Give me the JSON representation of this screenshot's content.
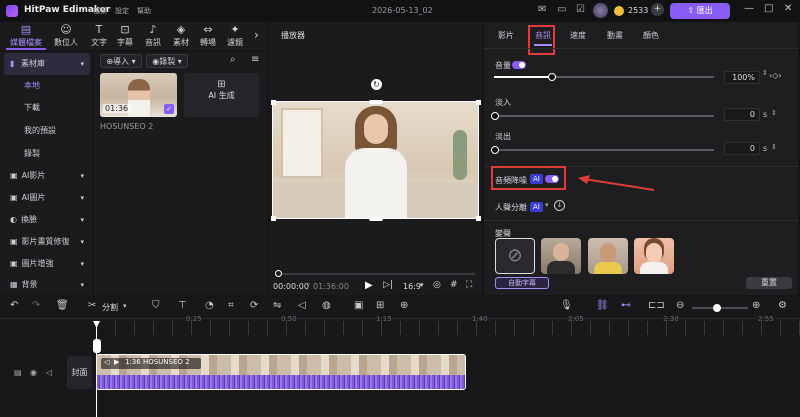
{
  "app": {
    "title": "HitPaw Edimakor",
    "date": "2026-05-13_02",
    "coins": "2533",
    "export_label": "匯出"
  },
  "menu": [
    "檔案",
    "設定",
    "幫助"
  ],
  "toolbar": [
    {
      "label": "媒體檔案",
      "icon": "media-icon"
    },
    {
      "label": "數位人",
      "icon": "avatar-icon"
    },
    {
      "label": "文字",
      "icon": "text-icon"
    },
    {
      "label": "字幕",
      "icon": "subtitle-icon"
    },
    {
      "label": "音訊",
      "icon": "music-icon"
    },
    {
      "label": "素材",
      "icon": "assets-icon"
    },
    {
      "label": "轉場",
      "icon": "transition-icon"
    },
    {
      "label": "濾鏡",
      "icon": "filter-icon"
    }
  ],
  "leftnav": {
    "library": "素材庫",
    "items": [
      "本地",
      "下載",
      "我的預設",
      "錄製"
    ],
    "groups": [
      "AI影片",
      "AI圖片",
      "換臉",
      "影片畫質修復",
      "圖片增強",
      "背景"
    ]
  },
  "mediabin": {
    "import_label": "導入",
    "record_label": "錄製",
    "clip_name": "HOSUNSEO 2",
    "clip_duration": "01:36",
    "ai_generate_label": "AI 生成"
  },
  "preview": {
    "title": "播放器",
    "current_time": "00:00:00",
    "total_time": "01:36:00",
    "ratio": "16:9"
  },
  "props": {
    "tabs": [
      "影片",
      "音訊",
      "速度",
      "動畫",
      "顏色"
    ],
    "active_tab": "音訊",
    "volume_label": "音量",
    "volume_value": "100%",
    "volume_level": 1.0,
    "fade_in_label": "淡入",
    "fade_in_value": "0",
    "fade_out_label": "淡出",
    "fade_out_value": "0",
    "unit_s": "s",
    "noise_label": "音頻降噪",
    "ai_badge": "AI",
    "vocal_label": "人聲分離",
    "voice_change_label": "變聲",
    "auto_subtitle_label": "自動字幕",
    "reset_label": "重置"
  },
  "timeline": {
    "ticks": [
      "0:25",
      "0:50",
      "1:15",
      "1:40",
      "2:05",
      "2:30",
      "2:55"
    ],
    "split_label": "分割",
    "cover_label": "封面",
    "clip_label": "1:36 HOSUNSEO 2"
  },
  "colors": {
    "accent": "#8a5cf6",
    "highlight": "#e03a3a",
    "export": "#8a5cf6"
  }
}
